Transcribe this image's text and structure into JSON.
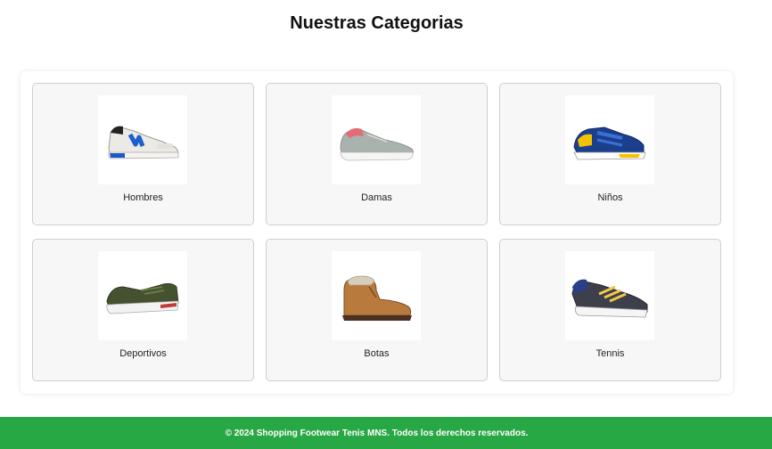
{
  "page": {
    "title": "Nuestras Categorias"
  },
  "categories": [
    {
      "label": "Hombres",
      "icon": "men-sneaker-icon"
    },
    {
      "label": "Damas",
      "icon": "women-sneaker-icon"
    },
    {
      "label": "Niños",
      "icon": "kids-sneaker-icon"
    },
    {
      "label": "Deportivos",
      "icon": "sport-shoe-icon"
    },
    {
      "label": "Botas",
      "icon": "boot-icon"
    },
    {
      "label": "Tennis",
      "icon": "tennis-shoe-icon"
    }
  ],
  "footer": {
    "text": "© 2024 Shopping Footwear Tenis MNS. Todos los derechos reservados."
  },
  "colors": {
    "footer_bg": "#28a745",
    "card_bg": "#f7f7f7"
  }
}
